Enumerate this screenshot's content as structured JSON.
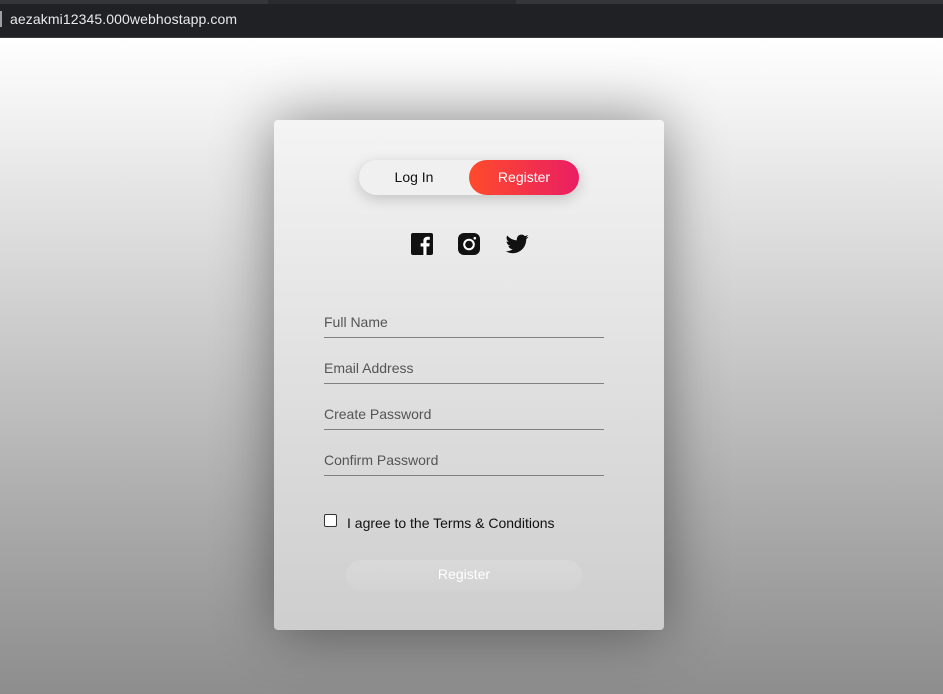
{
  "browser": {
    "url": "aezakmi12345.000webhostapp.com"
  },
  "form": {
    "toggle": {
      "login_label": "Log In",
      "register_label": "Register",
      "active": "Register"
    },
    "social_icons": [
      "facebook-icon",
      "instagram-icon",
      "twitter-icon"
    ],
    "fields": [
      {
        "placeholder": "Full Name",
        "value": ""
      },
      {
        "placeholder": "Email Address",
        "value": ""
      },
      {
        "placeholder": "Create Password",
        "value": ""
      },
      {
        "placeholder": "Confirm Password",
        "value": ""
      }
    ],
    "terms": {
      "label": "I agree to the Terms & Conditions",
      "checked": false
    },
    "submit_label": "Register"
  },
  "colors": {
    "accent_start": "#ff4b2b",
    "accent_end": "#e91e63",
    "topbar": "#202124"
  }
}
